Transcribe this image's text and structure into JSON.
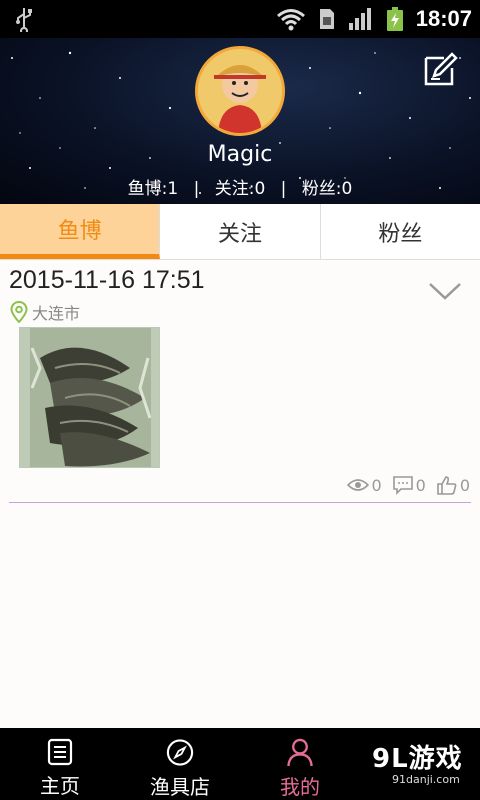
{
  "status_bar": {
    "time": "18:07"
  },
  "profile": {
    "username": "Magic",
    "stats": [
      {
        "label": "鱼博",
        "value": "1",
        "text": "鱼博:1"
      },
      {
        "label": "关注",
        "value": "0",
        "text": "关注:0"
      },
      {
        "label": "粉丝",
        "value": "0",
        "text": "粉丝:0"
      }
    ],
    "separator": "|"
  },
  "tabs": [
    {
      "label": "鱼博",
      "active": true
    },
    {
      "label": "关注",
      "active": false
    },
    {
      "label": "粉丝",
      "active": false
    }
  ],
  "post": {
    "datetime": "2015-11-16 17:51",
    "location": "大连市",
    "views": "0",
    "comments": "0",
    "likes": "0"
  },
  "bottom_nav": [
    {
      "label": "主页",
      "icon": "home-icon",
      "active": false
    },
    {
      "label": "渔具店",
      "icon": "compass-icon",
      "active": false
    },
    {
      "label": "我的",
      "icon": "person-icon",
      "active": true
    }
  ],
  "watermark": {
    "brand": "9L游戏",
    "url": "91danji.com"
  },
  "colors": {
    "accent": "#f28a12",
    "tab_active_bg": "#fdd39a",
    "nav_active": "#e66e96"
  }
}
